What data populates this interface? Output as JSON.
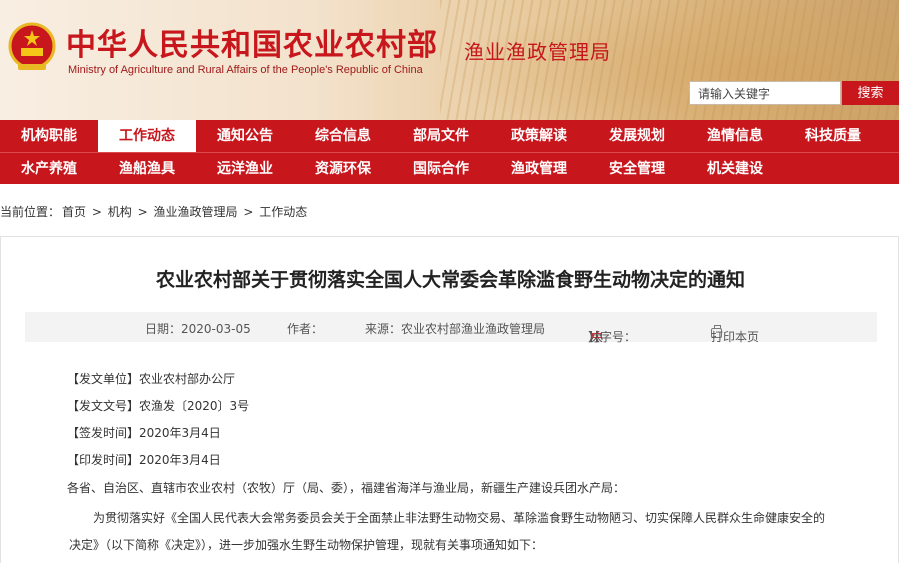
{
  "header": {
    "title_cn": "中华人民共和国农业农村部",
    "title_en": "Ministry of Agriculture and Rural Affairs of the People's Republic of China",
    "bureau": "渔业渔政管理局",
    "search_placeholder": "请输入关键字",
    "search_button": "搜索"
  },
  "nav": {
    "row1": [
      "机构职能",
      "工作动态",
      "通知公告",
      "综合信息",
      "部局文件",
      "政策解读",
      "发展规划",
      "渔情信息",
      "科技质量"
    ],
    "row2": [
      "水产养殖",
      "渔船渔具",
      "远洋渔业",
      "资源环保",
      "国际合作",
      "渔政管理",
      "安全管理",
      "机关建设"
    ],
    "active": "工作动态"
  },
  "breadcrumb": {
    "prefix": "当前位置：",
    "items": [
      "首页",
      "机构",
      "渔业渔政管理局",
      "工作动态"
    ],
    "separator": ">"
  },
  "article": {
    "title": "农业农村部关于贯彻落实全国人大常委会革除滥食野生动物决定的通知",
    "meta": {
      "date": "日期：2020-03-05",
      "author": "作者：",
      "source": "来源：农业农村部渔业渔政管理局",
      "size_prefix": "【字号：",
      "size_large": "大",
      "size_medium": "中",
      "size_small": "小",
      "size_suffix": "】",
      "print": "打印本页"
    },
    "fields": [
      "【发文单位】农业农村部办公厅",
      "【发文文号】农渔发〔2020〕3号",
      "【签发时间】2020年3月4日",
      "【印发时间】2020年3月4日"
    ],
    "addressee": "各省、自治区、直辖市农业农村（农牧）厅（局、委），福建省海洋与渔业局，新疆生产建设兵团水产局：",
    "paragraph_1": "为贯彻落实好《全国人民代表大会常务委员会关于全面禁止非法野生动物交易、革除滥食野生动物陋习、切实保障人民群众生命健康安全的",
    "paragraph_1b": "决定》（以下简称《决定》），进一步加强水生野生动物保护管理，现就有关事项通知如下："
  },
  "colors": {
    "brand_red": "#c8161d"
  }
}
